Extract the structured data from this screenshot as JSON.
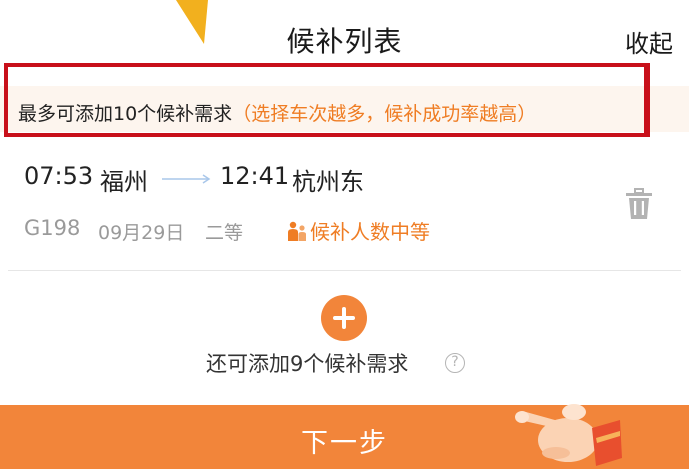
{
  "header": {
    "title": "候补列表",
    "collapse_label": "收起"
  },
  "notice": {
    "text": "最多可添加10个候补需求",
    "hint": "（选择车次越多，候补成功率越高）"
  },
  "trip": {
    "departure_time": "07:53",
    "departure_station": "福州",
    "arrival_time": "12:41",
    "arrival_station": "杭州东",
    "train_number": "G198",
    "date": "09月29日",
    "seat_class": "二等",
    "queue_status": "候补人数中等"
  },
  "add_section": {
    "remaining_text": "还可添加9个候补需求",
    "help_glyph": "?"
  },
  "footer": {
    "next_label": "下一步"
  },
  "icons": {
    "delete": "trash-icon",
    "add": "plus-icon",
    "help": "question-circle-icon",
    "queue": "people-icon",
    "hand": "pointing-hand-icon"
  },
  "colors": {
    "accent": "#f2853a",
    "hint_orange": "#ef7d24",
    "highlight_border": "#c8101a",
    "notice_bg": "#fdf5ee",
    "muted_gray": "#9a9a9a"
  }
}
